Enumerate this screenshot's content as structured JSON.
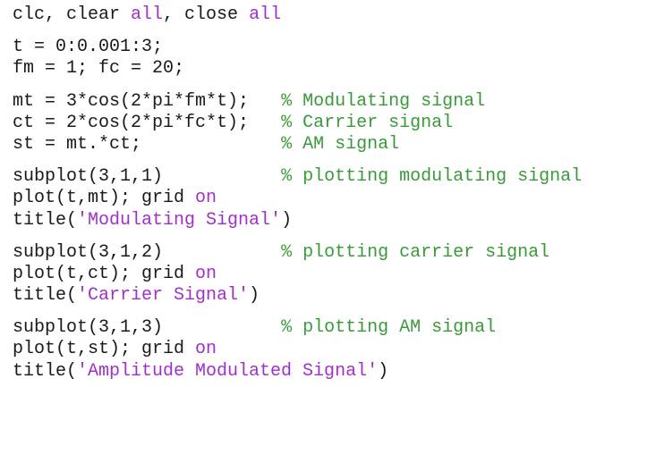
{
  "editor": {
    "colors": {
      "background": "#ffffff",
      "text": "#1a1a1a",
      "keyword": "#a030c8",
      "string": "#a030c8",
      "comment": "#3a9a3a"
    },
    "lines": [
      {
        "name": "line-clear",
        "tokens": [
          {
            "type": "tok",
            "text": "clc, clear "
          },
          {
            "type": "kw",
            "text": "all"
          },
          {
            "type": "tok",
            "text": ", close "
          },
          {
            "type": "kw",
            "text": "all"
          }
        ]
      },
      {
        "blank": true
      },
      {
        "name": "line-time",
        "tokens": [
          {
            "type": "tok",
            "text": "t = 0:0.001:3;"
          }
        ]
      },
      {
        "name": "line-freq",
        "tokens": [
          {
            "type": "tok",
            "text": "fm = 1; fc = 20;"
          }
        ]
      },
      {
        "blank": true
      },
      {
        "name": "line-mt",
        "tokens": [
          {
            "type": "tok",
            "text": "mt = 3*cos(2*pi*fm*t);   "
          },
          {
            "type": "cmt",
            "text": "% Modulating signal"
          }
        ]
      },
      {
        "name": "line-ct",
        "tokens": [
          {
            "type": "tok",
            "text": "ct = 2*cos(2*pi*fc*t);   "
          },
          {
            "type": "cmt",
            "text": "% Carrier signal"
          }
        ]
      },
      {
        "name": "line-st",
        "tokens": [
          {
            "type": "tok",
            "text": "st = mt.*ct;             "
          },
          {
            "type": "cmt",
            "text": "% AM signal"
          }
        ]
      },
      {
        "blank": true
      },
      {
        "name": "line-subplot-1",
        "tokens": [
          {
            "type": "tok",
            "text": "subplot(3,1,1)           "
          },
          {
            "type": "cmt",
            "text": "% plotting modulating signal"
          }
        ]
      },
      {
        "name": "line-plot-1",
        "tokens": [
          {
            "type": "tok",
            "text": "plot(t,mt); grid "
          },
          {
            "type": "kw",
            "text": "on"
          }
        ]
      },
      {
        "name": "line-title-1",
        "tokens": [
          {
            "type": "tok",
            "text": "title("
          },
          {
            "type": "str",
            "text": "'Modulating Signal'"
          },
          {
            "type": "tok",
            "text": ")"
          }
        ]
      },
      {
        "blank": true
      },
      {
        "name": "line-subplot-2",
        "tokens": [
          {
            "type": "tok",
            "text": "subplot(3,1,2)           "
          },
          {
            "type": "cmt",
            "text": "% plotting carrier signal"
          }
        ]
      },
      {
        "name": "line-plot-2",
        "tokens": [
          {
            "type": "tok",
            "text": "plot(t,ct); grid "
          },
          {
            "type": "kw",
            "text": "on"
          }
        ]
      },
      {
        "name": "line-title-2",
        "tokens": [
          {
            "type": "tok",
            "text": "title("
          },
          {
            "type": "str",
            "text": "'Carrier Signal'"
          },
          {
            "type": "tok",
            "text": ")"
          }
        ]
      },
      {
        "blank": true
      },
      {
        "name": "line-subplot-3",
        "tokens": [
          {
            "type": "tok",
            "text": "subplot(3,1,3)           "
          },
          {
            "type": "cmt",
            "text": "% plotting AM signal"
          }
        ]
      },
      {
        "name": "line-plot-3",
        "tokens": [
          {
            "type": "tok",
            "text": "plot(t,st); grid "
          },
          {
            "type": "kw",
            "text": "on"
          }
        ]
      },
      {
        "name": "line-title-3",
        "tokens": [
          {
            "type": "tok",
            "text": "title("
          },
          {
            "type": "str",
            "text": "'Amplitude Modulated Signal'"
          },
          {
            "type": "tok",
            "text": ")"
          }
        ]
      }
    ]
  }
}
